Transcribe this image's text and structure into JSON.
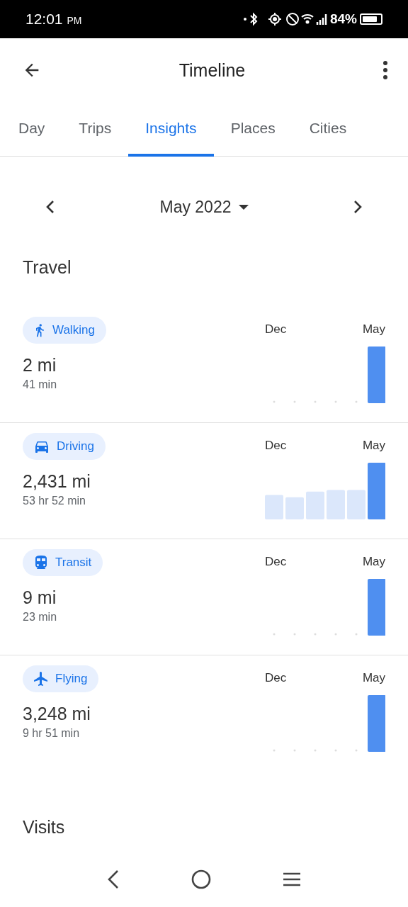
{
  "status_bar": {
    "time": "12:01",
    "ampm": "PM",
    "battery_text": "84%"
  },
  "app_bar": {
    "title": "Timeline"
  },
  "tabs": [
    {
      "label": "Day",
      "selected": false
    },
    {
      "label": "Trips",
      "selected": false
    },
    {
      "label": "Insights",
      "selected": true
    },
    {
      "label": "Places",
      "selected": false
    },
    {
      "label": "Cities",
      "selected": false
    }
  ],
  "period": {
    "label": "May 2022"
  },
  "travel": {
    "heading": "Travel",
    "rows": [
      {
        "kind": "walking",
        "label": "Walking",
        "distance": "2 mi",
        "duration": "41 min",
        "chart_start": "Dec",
        "chart_end": "May"
      },
      {
        "kind": "driving",
        "label": "Driving",
        "distance": "2,431 mi",
        "duration": "53 hr 52 min",
        "chart_start": "Dec",
        "chart_end": "May"
      },
      {
        "kind": "transit",
        "label": "Transit",
        "distance": "9 mi",
        "duration": "23 min",
        "chart_start": "Dec",
        "chart_end": "May"
      },
      {
        "kind": "flying",
        "label": "Flying",
        "distance": "3,248 mi",
        "duration": "9 hr 51 min",
        "chart_start": "Dec",
        "chart_end": "May"
      }
    ]
  },
  "visits": {
    "heading": "Visits"
  }
}
